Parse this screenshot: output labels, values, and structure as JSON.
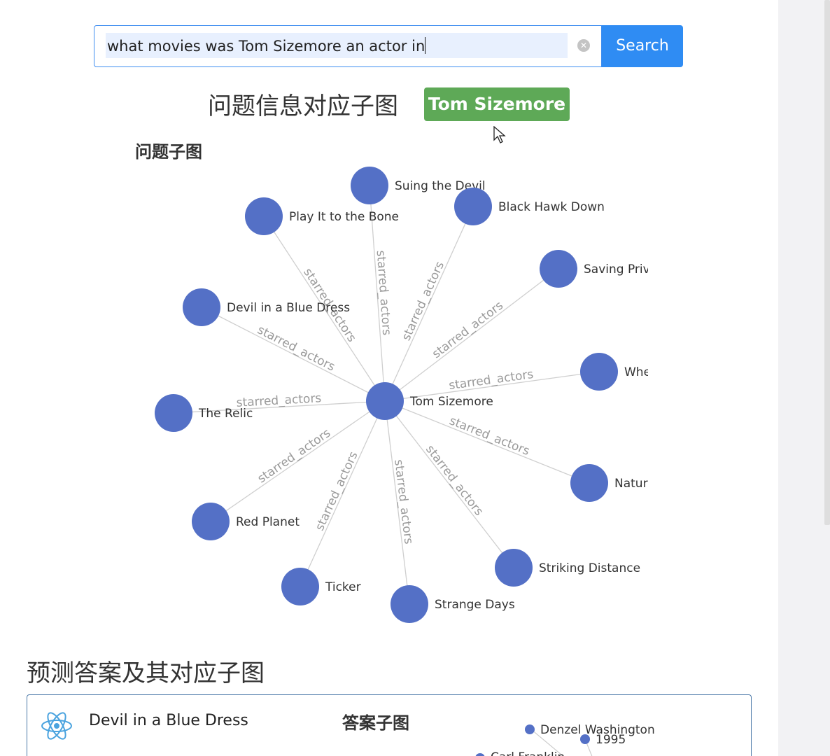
{
  "search": {
    "query": "what movies was Tom Sizemore an actor in",
    "clear_icon": "close-circle-icon",
    "button_label": "Search"
  },
  "subgraph_heading": "问题信息对应子图",
  "entity_tag": "Tom Sizemore",
  "question_subgraph_label": "问题子图",
  "graph": {
    "center": "Tom Sizemore",
    "edge_label": "starred_actors",
    "node_color": "#5470c6",
    "nodes": [
      "Suing the Devil",
      "Play It to the Bone",
      "Black Hawk Down",
      "Saving Priv",
      "Devil in a Blue Dress",
      "Whe",
      "The Relic",
      "Natur",
      "Red Planet",
      "Striking Distance",
      "Ticker",
      "Strange Days"
    ]
  },
  "answers_heading": "预测答案及其对应子图",
  "answer": {
    "icon": "react-atom-icon",
    "title": "Devil in a Blue Dress",
    "subgraph_label": "答案子图",
    "mini_nodes": [
      "Denzel Washington",
      "1995",
      "Carl Franklin"
    ]
  }
}
